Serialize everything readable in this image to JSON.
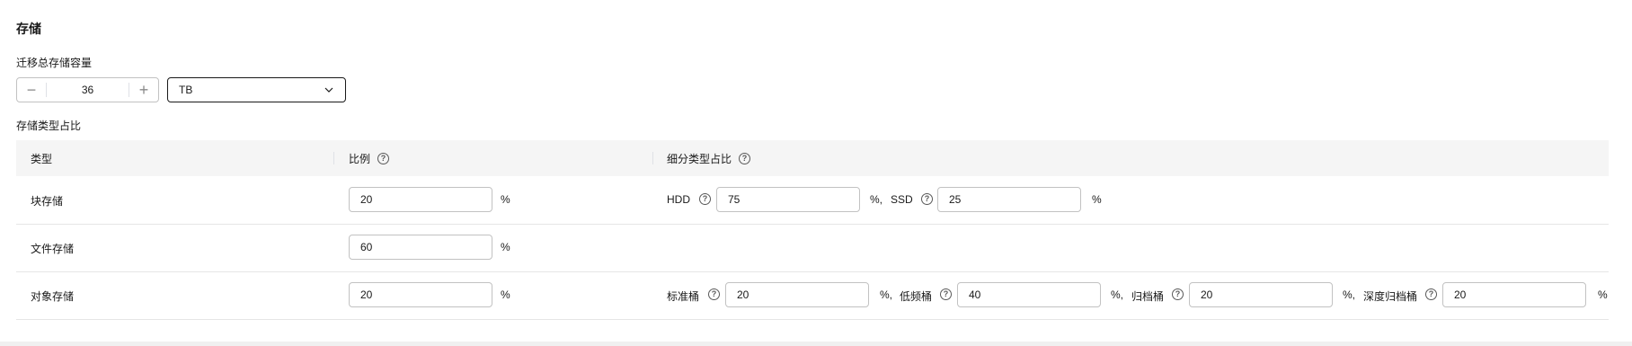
{
  "section": {
    "title": "存储"
  },
  "capacity": {
    "label": "迁移总存储容量",
    "value": "36",
    "unit_selected": "TB"
  },
  "ratio": {
    "label": "存储类型占比",
    "headers": {
      "type": "类型",
      "ratio": "比例",
      "breakdown": "细分类型占比"
    },
    "percent": "%",
    "rows": [
      {
        "type": "块存储",
        "value": "20",
        "sub": [
          {
            "label": "HDD",
            "value": "75",
            "unit": "%,"
          },
          {
            "label": "SSD",
            "value": "25",
            "unit": "%"
          }
        ]
      },
      {
        "type": "文件存储",
        "value": "60"
      },
      {
        "type": "对象存储",
        "value": "20",
        "sub": [
          {
            "label": "标准桶",
            "value": "20",
            "unit": "%,"
          },
          {
            "label": "低频桶",
            "value": "40",
            "unit": "%,"
          },
          {
            "label": "归档桶",
            "value": "20",
            "unit": "%,"
          },
          {
            "label": "深度归档桶",
            "value": "20",
            "unit": "%"
          }
        ]
      }
    ]
  },
  "icons": {
    "help": "question-circle-icon",
    "minus": "minus-icon",
    "plus": "plus-icon",
    "dropdown": "chevron-down-icon"
  }
}
